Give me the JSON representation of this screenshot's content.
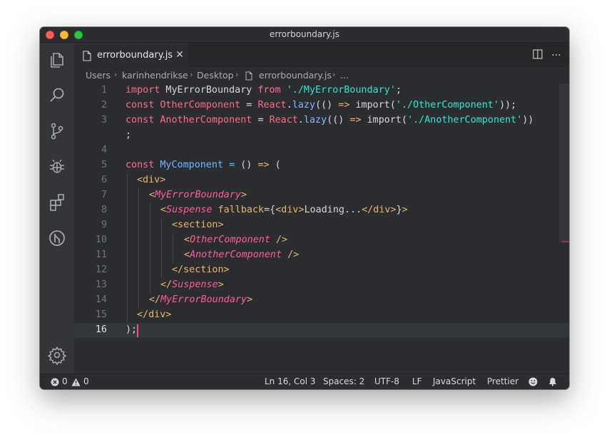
{
  "window": {
    "title": "errorboundary.js"
  },
  "activity_bar": {
    "icons": [
      "files-icon",
      "search-icon",
      "source-control-icon",
      "debug-icon",
      "extensions-icon",
      "gitlens-icon",
      "gear-icon"
    ]
  },
  "tab": {
    "label": "errorboundary.js",
    "close": "✕"
  },
  "tab_actions": {
    "split": "split-editor-icon",
    "more": "···"
  },
  "breadcrumb": {
    "items": [
      "Users",
      "karinhendrikse",
      "Desktop",
      "errorboundary.js",
      "..."
    ],
    "separator": "›"
  },
  "editor": {
    "line_numbers": [
      "1",
      "2",
      "3",
      "",
      "4",
      "5",
      "6",
      "7",
      "8",
      "9",
      "10",
      "11",
      "12",
      "13",
      "14",
      "15",
      "16"
    ],
    "current_line": "16",
    "tokens": {
      "l1": [
        [
          "k",
          "import"
        ],
        [
          "pl",
          " MyErrorBoundary "
        ],
        [
          "k",
          "from"
        ],
        [
          "pl",
          " "
        ],
        [
          "s",
          "'./MyErrorBoundary'"
        ],
        [
          "pl",
          ";"
        ]
      ],
      "l2": [
        [
          "k",
          "const"
        ],
        [
          "pl",
          " "
        ],
        [
          "d",
          "OtherComponent"
        ],
        [
          "pl",
          " = "
        ],
        [
          "d",
          "React"
        ],
        [
          "pl",
          "."
        ],
        [
          "fn",
          "lazy"
        ],
        [
          "pl",
          "(() "
        ],
        [
          "p",
          "=>"
        ],
        [
          "pl",
          " import("
        ],
        [
          "s",
          "'./OtherComponent'"
        ],
        [
          "pl",
          "));"
        ]
      ],
      "l3": [
        [
          "k",
          "const"
        ],
        [
          "pl",
          " "
        ],
        [
          "d",
          "AnotherComponent"
        ],
        [
          "pl",
          " = "
        ],
        [
          "d",
          "React"
        ],
        [
          "pl",
          "."
        ],
        [
          "fn",
          "lazy"
        ],
        [
          "pl",
          "(() "
        ],
        [
          "p",
          "=>"
        ],
        [
          "pl",
          " import("
        ],
        [
          "s",
          "'./AnotherComponent'"
        ],
        [
          "pl",
          "))"
        ]
      ],
      "l3b": [
        [
          "pl",
          ";"
        ]
      ],
      "l4": [],
      "l5": [
        [
          "k",
          "const"
        ],
        [
          "pl",
          " "
        ],
        [
          "ty2",
          "MyComponent"
        ],
        [
          "pl",
          " "
        ],
        [
          "ty2",
          "="
        ],
        [
          "pl",
          " () "
        ],
        [
          "p",
          "=>"
        ],
        [
          "pl",
          " ("
        ]
      ],
      "l6": [
        [
          "tg",
          "<div>"
        ]
      ],
      "l7": [
        [
          "tg",
          "<"
        ],
        [
          "tc",
          "MyErrorBoundary"
        ],
        [
          "tg",
          ">"
        ]
      ],
      "l8": [
        [
          "tg",
          "<"
        ],
        [
          "tc",
          "Suspense"
        ],
        [
          "pl",
          " "
        ],
        [
          "at",
          "fallback"
        ],
        [
          "pl",
          "={"
        ],
        [
          "tg",
          "<div>"
        ],
        [
          "pl",
          "Loading..."
        ],
        [
          "tg",
          "</div>"
        ],
        [
          "pl",
          "}"
        ],
        [
          "tg",
          ">"
        ]
      ],
      "l9": [
        [
          "tg",
          "<section>"
        ]
      ],
      "l10": [
        [
          "tg",
          "<"
        ],
        [
          "tc",
          "OtherComponent"
        ],
        [
          "pl",
          " "
        ],
        [
          "tg",
          "/>"
        ]
      ],
      "l11": [
        [
          "tg",
          "<"
        ],
        [
          "tc",
          "AnotherComponent"
        ],
        [
          "pl",
          " "
        ],
        [
          "tg",
          "/>"
        ]
      ],
      "l12": [
        [
          "tg",
          "</section>"
        ]
      ],
      "l13": [
        [
          "tg",
          "</"
        ],
        [
          "tc",
          "Suspense"
        ],
        [
          "tg",
          ">"
        ]
      ],
      "l14": [
        [
          "tg",
          "</"
        ],
        [
          "tc",
          "MyErrorBoundary"
        ],
        [
          "tg",
          ">"
        ]
      ],
      "l15": [
        [
          "tg",
          "</div>"
        ]
      ],
      "l16": [
        [
          "pl",
          ");"
        ]
      ]
    }
  },
  "status_bar": {
    "errors": "0",
    "warnings": "0",
    "position": "Ln 16, Col 3",
    "spaces": "Spaces: 2",
    "encoding": "UTF-8",
    "eol": "LF",
    "language": "JavaScript",
    "formatter": "Prettier"
  },
  "colors": {
    "keyword": "#ff6a8a",
    "string": "#2ee6d0",
    "tag": "#e8b56c",
    "component": "#ff5aa0",
    "cursor": "#ff4f7a",
    "background": "#2b2d31"
  }
}
